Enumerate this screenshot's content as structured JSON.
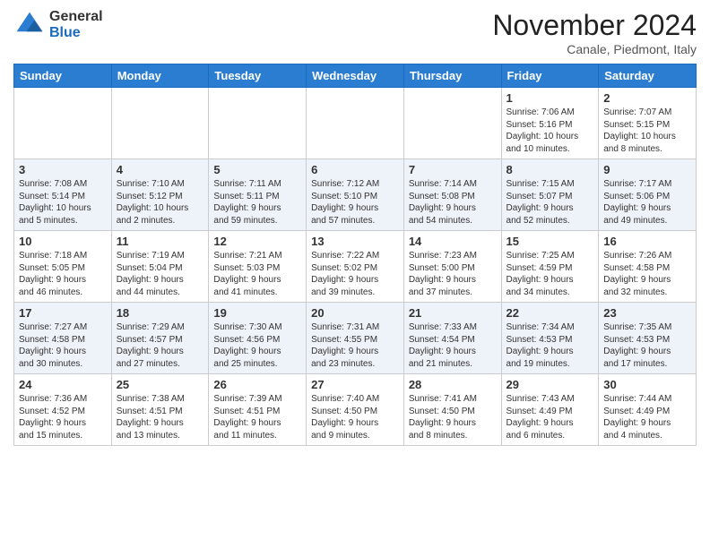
{
  "header": {
    "logo_line1": "General",
    "logo_line2": "Blue",
    "month": "November 2024",
    "location": "Canale, Piedmont, Italy"
  },
  "weekdays": [
    "Sunday",
    "Monday",
    "Tuesday",
    "Wednesday",
    "Thursday",
    "Friday",
    "Saturday"
  ],
  "weeks": [
    [
      {
        "day": "",
        "info": ""
      },
      {
        "day": "",
        "info": ""
      },
      {
        "day": "",
        "info": ""
      },
      {
        "day": "",
        "info": ""
      },
      {
        "day": "",
        "info": ""
      },
      {
        "day": "1",
        "info": "Sunrise: 7:06 AM\nSunset: 5:16 PM\nDaylight: 10 hours\nand 10 minutes."
      },
      {
        "day": "2",
        "info": "Sunrise: 7:07 AM\nSunset: 5:15 PM\nDaylight: 10 hours\nand 8 minutes."
      }
    ],
    [
      {
        "day": "3",
        "info": "Sunrise: 7:08 AM\nSunset: 5:14 PM\nDaylight: 10 hours\nand 5 minutes."
      },
      {
        "day": "4",
        "info": "Sunrise: 7:10 AM\nSunset: 5:12 PM\nDaylight: 10 hours\nand 2 minutes."
      },
      {
        "day": "5",
        "info": "Sunrise: 7:11 AM\nSunset: 5:11 PM\nDaylight: 9 hours\nand 59 minutes."
      },
      {
        "day": "6",
        "info": "Sunrise: 7:12 AM\nSunset: 5:10 PM\nDaylight: 9 hours\nand 57 minutes."
      },
      {
        "day": "7",
        "info": "Sunrise: 7:14 AM\nSunset: 5:08 PM\nDaylight: 9 hours\nand 54 minutes."
      },
      {
        "day": "8",
        "info": "Sunrise: 7:15 AM\nSunset: 5:07 PM\nDaylight: 9 hours\nand 52 minutes."
      },
      {
        "day": "9",
        "info": "Sunrise: 7:17 AM\nSunset: 5:06 PM\nDaylight: 9 hours\nand 49 minutes."
      }
    ],
    [
      {
        "day": "10",
        "info": "Sunrise: 7:18 AM\nSunset: 5:05 PM\nDaylight: 9 hours\nand 46 minutes."
      },
      {
        "day": "11",
        "info": "Sunrise: 7:19 AM\nSunset: 5:04 PM\nDaylight: 9 hours\nand 44 minutes."
      },
      {
        "day": "12",
        "info": "Sunrise: 7:21 AM\nSunset: 5:03 PM\nDaylight: 9 hours\nand 41 minutes."
      },
      {
        "day": "13",
        "info": "Sunrise: 7:22 AM\nSunset: 5:02 PM\nDaylight: 9 hours\nand 39 minutes."
      },
      {
        "day": "14",
        "info": "Sunrise: 7:23 AM\nSunset: 5:00 PM\nDaylight: 9 hours\nand 37 minutes."
      },
      {
        "day": "15",
        "info": "Sunrise: 7:25 AM\nSunset: 4:59 PM\nDaylight: 9 hours\nand 34 minutes."
      },
      {
        "day": "16",
        "info": "Sunrise: 7:26 AM\nSunset: 4:58 PM\nDaylight: 9 hours\nand 32 minutes."
      }
    ],
    [
      {
        "day": "17",
        "info": "Sunrise: 7:27 AM\nSunset: 4:58 PM\nDaylight: 9 hours\nand 30 minutes."
      },
      {
        "day": "18",
        "info": "Sunrise: 7:29 AM\nSunset: 4:57 PM\nDaylight: 9 hours\nand 27 minutes."
      },
      {
        "day": "19",
        "info": "Sunrise: 7:30 AM\nSunset: 4:56 PM\nDaylight: 9 hours\nand 25 minutes."
      },
      {
        "day": "20",
        "info": "Sunrise: 7:31 AM\nSunset: 4:55 PM\nDaylight: 9 hours\nand 23 minutes."
      },
      {
        "day": "21",
        "info": "Sunrise: 7:33 AM\nSunset: 4:54 PM\nDaylight: 9 hours\nand 21 minutes."
      },
      {
        "day": "22",
        "info": "Sunrise: 7:34 AM\nSunset: 4:53 PM\nDaylight: 9 hours\nand 19 minutes."
      },
      {
        "day": "23",
        "info": "Sunrise: 7:35 AM\nSunset: 4:53 PM\nDaylight: 9 hours\nand 17 minutes."
      }
    ],
    [
      {
        "day": "24",
        "info": "Sunrise: 7:36 AM\nSunset: 4:52 PM\nDaylight: 9 hours\nand 15 minutes."
      },
      {
        "day": "25",
        "info": "Sunrise: 7:38 AM\nSunset: 4:51 PM\nDaylight: 9 hours\nand 13 minutes."
      },
      {
        "day": "26",
        "info": "Sunrise: 7:39 AM\nSunset: 4:51 PM\nDaylight: 9 hours\nand 11 minutes."
      },
      {
        "day": "27",
        "info": "Sunrise: 7:40 AM\nSunset: 4:50 PM\nDaylight: 9 hours\nand 9 minutes."
      },
      {
        "day": "28",
        "info": "Sunrise: 7:41 AM\nSunset: 4:50 PM\nDaylight: 9 hours\nand 8 minutes."
      },
      {
        "day": "29",
        "info": "Sunrise: 7:43 AM\nSunset: 4:49 PM\nDaylight: 9 hours\nand 6 minutes."
      },
      {
        "day": "30",
        "info": "Sunrise: 7:44 AM\nSunset: 4:49 PM\nDaylight: 9 hours\nand 4 minutes."
      }
    ]
  ]
}
